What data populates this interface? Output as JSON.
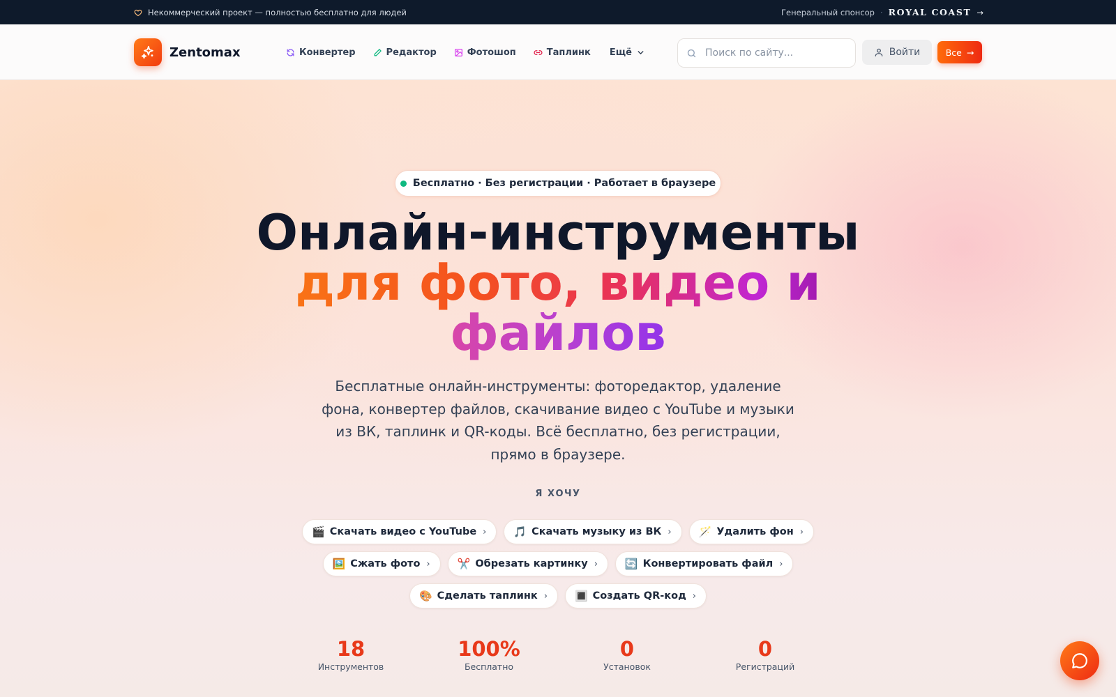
{
  "topbar": {
    "notice": "Некоммерческий проект — полностью бесплатно для людей",
    "sponsor_label": "Генеральный спонсор",
    "separator": "·",
    "sponsor_name": "ROYAL COAST",
    "sponsor_arrow": "→"
  },
  "header": {
    "logo_text": "Zentomax",
    "nav": [
      {
        "label": "Конвертер",
        "icon": "refresh-icon",
        "color": "#8b5cf6"
      },
      {
        "label": "Редактор",
        "icon": "pencil-icon",
        "color": "#10b981"
      },
      {
        "label": "Фотошоп",
        "icon": "image-icon",
        "color": "#d946ef"
      },
      {
        "label": "Таплинк",
        "icon": "link-icon",
        "color": "#e11d48"
      },
      {
        "label": "Ещё",
        "icon": "chevron-down-icon",
        "color": "#334155"
      }
    ],
    "search_placeholder": "Поиск по сайту...",
    "login_label": "Войти",
    "all_label": "Все",
    "all_arrow": "→"
  },
  "hero": {
    "badge": "Бесплатно · Без регистрации · Работает в браузере",
    "title_line1": "Онлайн-инструменты",
    "title_line2": "для фото, видео и",
    "title_line3": "файлов",
    "subtitle": "Бесплатные онлайн-инструменты: фоторедактор, удаление фона, конвертер файлов, скачивание видео с YouTube и музыки из ВК, таплинк и QR-коды. Всё бесплатно, без регистрации, прямо в браузере.",
    "want_label": "Я ХОЧУ",
    "chips": [
      [
        {
          "emoji": "🎬",
          "label": "Скачать видео с YouTube"
        },
        {
          "emoji": "🎵",
          "label": "Скачать музыку из ВК"
        },
        {
          "emoji": "🪄",
          "label": "Удалить фон"
        }
      ],
      [
        {
          "emoji": "🖼️",
          "label": "Сжать фото"
        },
        {
          "emoji": "✂️",
          "label": "Обрезать картинку"
        },
        {
          "emoji": "🔄",
          "label": "Конвертировать файл"
        }
      ],
      [
        {
          "emoji": "🎨",
          "label": "Сделать таплинк"
        },
        {
          "emoji": "🔳",
          "label": "Создать QR-код"
        }
      ]
    ],
    "chip_chevron": "›"
  },
  "stats": [
    {
      "value": "18",
      "label": "Инструментов"
    },
    {
      "value": "100%",
      "label": "Бесплатно"
    },
    {
      "value": "0",
      "label": "Установок"
    },
    {
      "value": "0",
      "label": "Регистраций"
    }
  ],
  "colors": {
    "accent": "#ee3a14",
    "topbar_bg": "#0e1a2b",
    "stat_value": "#e8391a"
  }
}
